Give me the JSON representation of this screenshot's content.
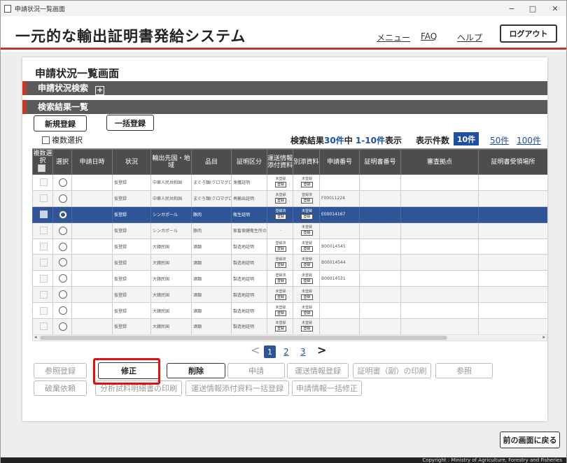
{
  "window": {
    "title": "申請状況一覧画面",
    "controls": [
      "−",
      "□",
      "✕"
    ]
  },
  "header": {
    "system_title": "一元的な輸出証明書発給システム",
    "menu": "メニュー",
    "faq": "FAQ",
    "help": "ヘルプ",
    "logout": "ログアウト"
  },
  "page": {
    "title": "申請状況一覧画面"
  },
  "sections": {
    "search": "申請状況検索",
    "results": "検索結果一覧"
  },
  "actions": {
    "new": "新規登録",
    "bulk": "一括登録"
  },
  "multi_select": "複数選択",
  "result_info": {
    "prefix": "検索結果",
    "total": "30件",
    "middle": "中",
    "range": "1-10件",
    "suffix": "表示"
  },
  "page_size": {
    "label": "表示件数",
    "selected": "10件",
    "options": [
      "50件",
      "100件"
    ]
  },
  "table": {
    "columns": [
      "複数選択",
      "選択",
      "申請日時",
      "状況",
      "輸出先国・地域",
      "品目",
      "証明区分",
      "運送情報添付資料",
      "別添資料",
      "申請番号",
      "証明書番号",
      "審査拠点",
      "証明書受領場所"
    ],
    "rows": [
      {
        "status": "仮登録",
        "country": "中華人民共和国",
        "item": "まぐろ類(クロマグロ)",
        "cert": "漁獲証明",
        "transport": "未登録",
        "attach": "未登録",
        "app_no": "",
        "selected": false
      },
      {
        "status": "仮登録",
        "country": "中華人民共和国",
        "item": "まぐろ類(クロマグロ)",
        "cert": "再輸出証明",
        "transport": "未登録",
        "attach": "登録済",
        "app_no": "F00011224",
        "selected": false
      },
      {
        "status": "仮登録",
        "country": "シンガポール",
        "item": "豚肉",
        "cert": "衛生証明",
        "transport": "登録済",
        "attach": "未登録",
        "app_no": "E00014167",
        "selected": true
      },
      {
        "status": "仮登録",
        "country": "シンガポール",
        "item": "豚肉",
        "cert": "家畜保健衛生所の確認書",
        "transport": "-",
        "attach": "未登録",
        "app_no": "",
        "selected": false
      },
      {
        "status": "仮登録",
        "country": "大韓民国",
        "item": "酒類",
        "cert": "製造地証明",
        "transport": "登録済",
        "attach": "未登録",
        "app_no": "B00014545",
        "selected": false
      },
      {
        "status": "仮登録",
        "country": "大韓民国",
        "item": "酒類",
        "cert": "製造地証明",
        "transport": "登録済",
        "attach": "未登録",
        "app_no": "B00014544",
        "selected": false
      },
      {
        "status": "仮登録",
        "country": "大韓民国",
        "item": "酒類",
        "cert": "製造地証明",
        "transport": "登録済",
        "attach": "未登録",
        "app_no": "B00014531",
        "selected": false
      },
      {
        "status": "仮登録",
        "country": "大韓民国",
        "item": "酒類",
        "cert": "製造地証明",
        "transport": "未登録",
        "attach": "未登録",
        "app_no": "",
        "selected": false
      },
      {
        "status": "仮登録",
        "country": "大韓民国",
        "item": "酒類",
        "cert": "製造地証明",
        "transport": "未登録",
        "attach": "未登録",
        "app_no": "",
        "selected": false
      },
      {
        "status": "仮登録",
        "country": "大韓民国",
        "item": "酒類",
        "cert": "製造地証明",
        "transport": "未登録",
        "attach": "未登録",
        "app_no": "",
        "selected": false
      }
    ],
    "mini_button": "登録"
  },
  "pagination": {
    "prev": "<",
    "pages": [
      "1",
      "2",
      "3"
    ],
    "current": "1",
    "next": ">"
  },
  "buttons": {
    "row1": [
      "参照登録",
      "修正",
      "削除",
      "申請",
      "運送情報登録",
      "証明書（副）の印刷",
      "参照"
    ],
    "row2": [
      "破棄依頼",
      "分析試料明細書の印刷",
      "運送情報添付資料一括登録",
      "申請情報一括修正"
    ]
  },
  "back": "前の画面に戻る",
  "footer": "Copyright : Ministry of Agriculture, Forestry and Fisheries",
  "colors": {
    "accent": "#c0392b",
    "primary": "#2f5597",
    "highlight": "#e01010"
  }
}
